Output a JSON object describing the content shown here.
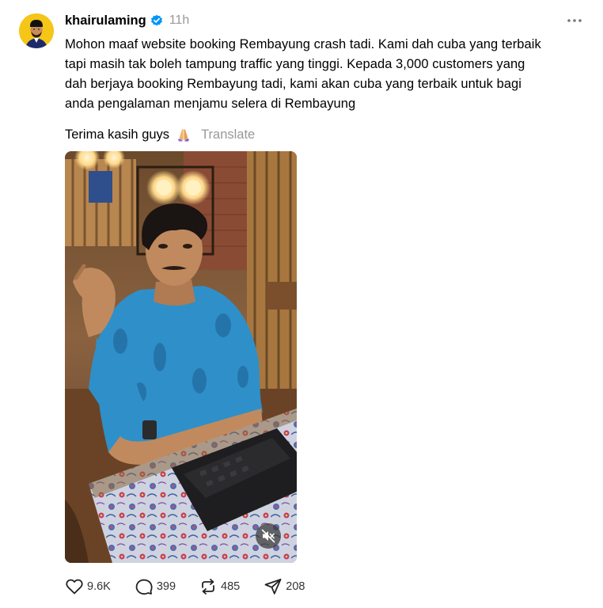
{
  "post": {
    "username": "khairulaming",
    "verified": true,
    "timestamp": "11h",
    "body_lines": [
      "Mohon maaf website booking Rembayung crash tadi. Kami dah cuba yang terbaik",
      "tapi masih tak boleh tampung traffic yang tinggi. Kepada 3,000 customers yang",
      "dah berjaya booking Rembayung tadi, kami akan cuba yang terbaik untuk bagi",
      "anda pengalaman menjamu selera di Rembayung"
    ],
    "thanks_text": "Terima kasih guys",
    "translate_label": "Translate",
    "stats": {
      "likes": "9.6K",
      "replies": "399",
      "reposts": "485",
      "shares": "208"
    }
  },
  "icons": {
    "verified": "verified-badge-icon",
    "emoji": "folded-hands-icon",
    "more": "more-horizontal-icon",
    "like": "heart-icon",
    "reply": "comment-icon",
    "repost": "repost-icon",
    "share": "send-icon",
    "mute": "speaker-muted-icon"
  },
  "colors": {
    "verified_blue": "#0095f6",
    "muted_text": "#999999",
    "avatar_bg": "#f5c518"
  }
}
